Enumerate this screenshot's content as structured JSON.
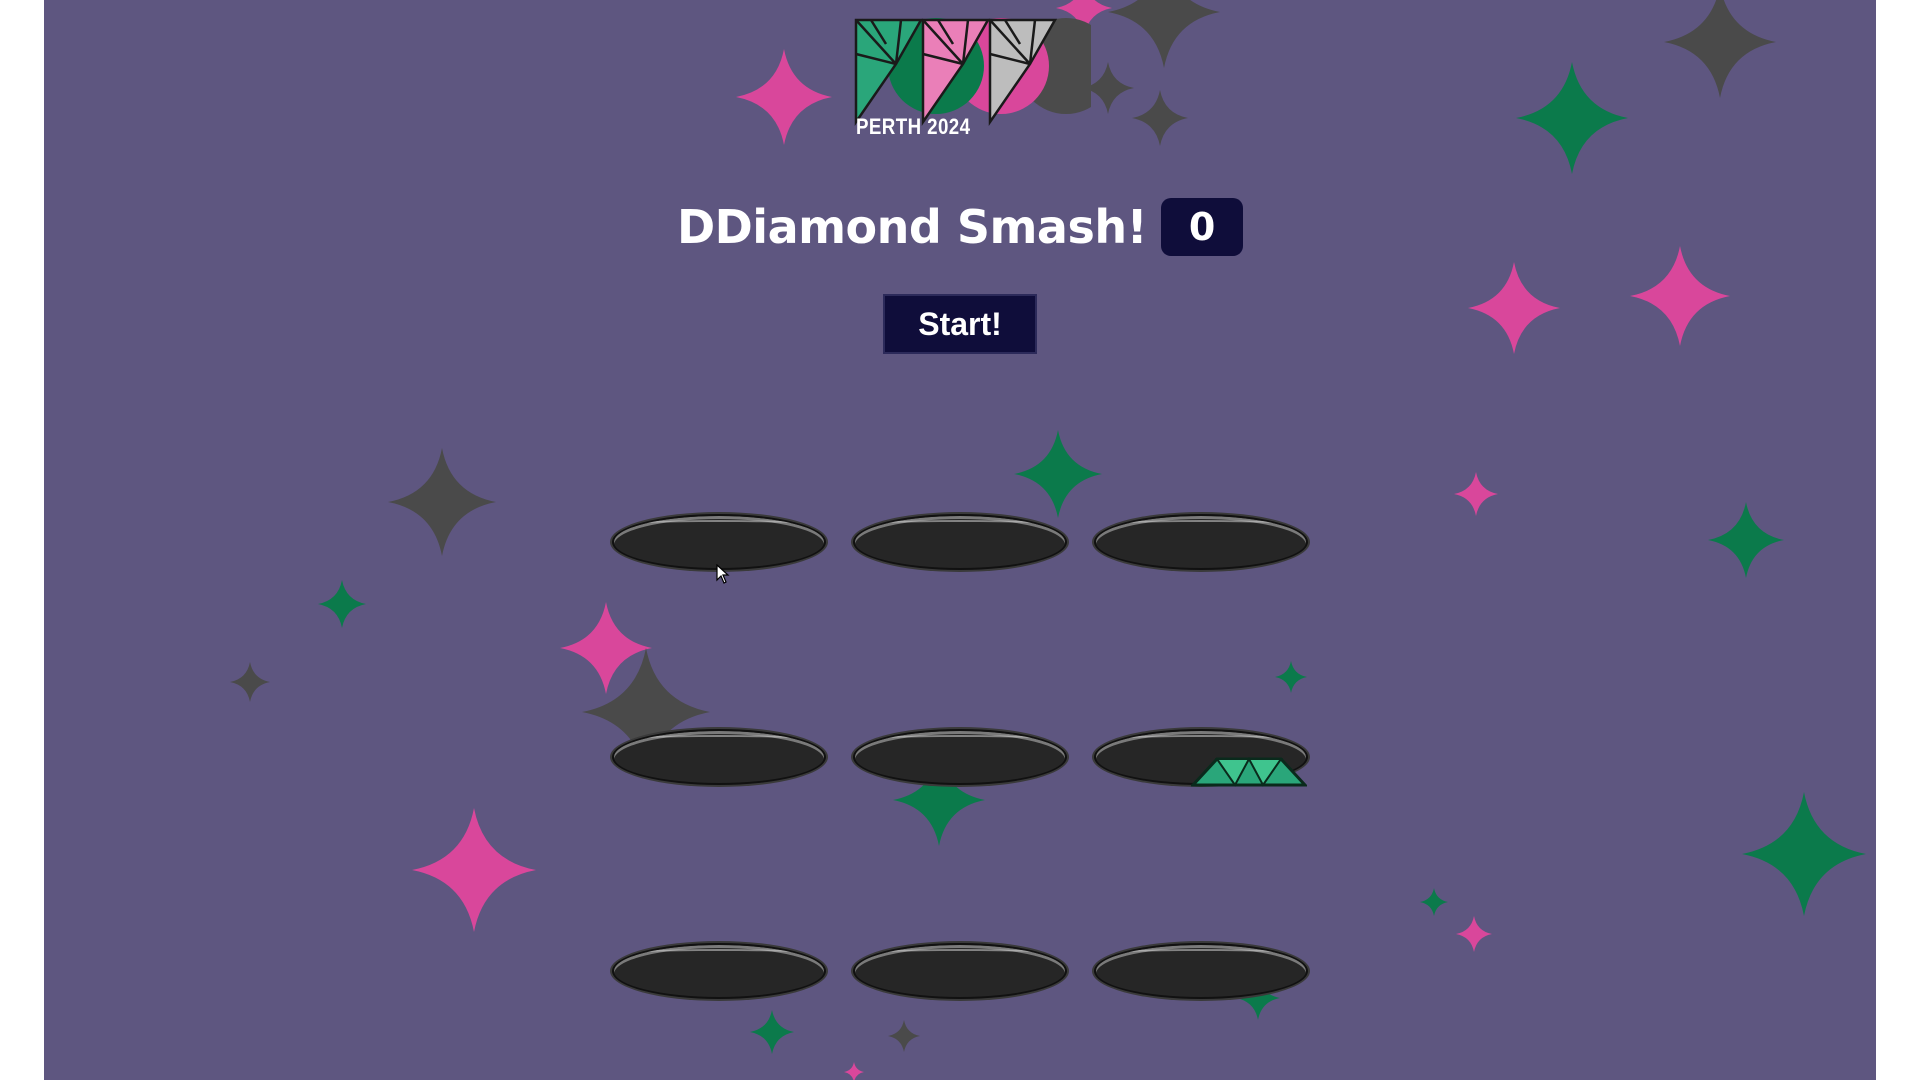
{
  "logo": {
    "text": "PERTH 2024"
  },
  "game": {
    "title": "DDiamond Smash!",
    "score": "0"
  },
  "controls": {
    "start_label": "Start!"
  },
  "holes": [
    {
      "row": 1,
      "col": 1,
      "has_gem": false
    },
    {
      "row": 1,
      "col": 2,
      "has_gem": false
    },
    {
      "row": 1,
      "col": 3,
      "has_gem": false
    },
    {
      "row": 2,
      "col": 1,
      "has_gem": false
    },
    {
      "row": 2,
      "col": 2,
      "has_gem": false
    },
    {
      "row": 2,
      "col": 3,
      "has_gem": true
    },
    {
      "row": 3,
      "col": 1,
      "has_gem": false
    },
    {
      "row": 3,
      "col": 2,
      "has_gem": false
    },
    {
      "row": 3,
      "col": 3,
      "has_gem": false
    }
  ],
  "colors": {
    "background": "#5e5680",
    "pink_sparkle": "#d9479b",
    "green_sparkle": "#0b7a4b",
    "grey_sparkle": "#4a4a4a",
    "button": "#0f0d3a",
    "hole": "#262626"
  }
}
